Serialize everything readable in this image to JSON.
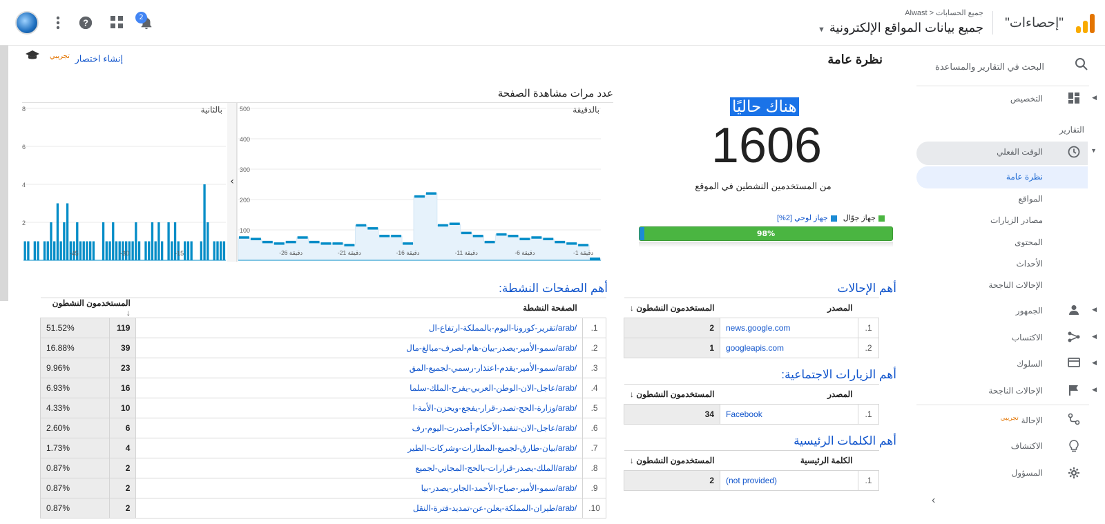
{
  "topbar": {
    "product_name": "\"إحصاءات\"",
    "breadcrumb_root": "جميع الحسابات",
    "breadcrumb_sep": "<",
    "breadcrumb_account": "Alwast",
    "property": "جميع بيانات المواقع الإلكترونية",
    "notifications_count": "2",
    "icons": [
      "analytics-logo",
      "chevron-down-icon",
      "notifications-bell-icon",
      "apps-grid-icon",
      "help-icon",
      "more-vert-icon",
      "avatar"
    ]
  },
  "sidebar": {
    "search_label": "البحث في التقارير والمساعدة",
    "customization": "التخصيص",
    "reports_heading": "التقارير",
    "realtime": "الوقت الفعلي",
    "realtime_sub": [
      "نظرة عامة",
      "المواقع",
      "مصادر الزيارات",
      "المحتوى",
      "الأحداث",
      "الإحالات الناجحة"
    ],
    "audience": "الجمهور",
    "acquisition": "الاكتساب",
    "behavior": "السلوك",
    "conversions": "الإحالات الناجحة",
    "attribution": "الإحالة",
    "attribution_badge": "تجريبي",
    "discover": "الاكتشاف",
    "admin": "المسؤول",
    "collapse": "›"
  },
  "main": {
    "title": "نظرة عامة",
    "shortcut_label": "إنشاء اختصار",
    "shortcut_badge": "تجريبي"
  },
  "realtime": {
    "now_label": "هناك حاليًا",
    "active_count": "1606",
    "sub_label": "من المستخدمين النشطين في الموقع",
    "legend_mobile": "جهاز جوّال",
    "legend_tablet": "جهاز لوحي [2%]",
    "mobile_pct_label": "98%",
    "mobile_fraction": 0.98,
    "tablet_fraction": 0.02,
    "colors": {
      "mobile": "#4ab541",
      "tablet": "#1c8bd4",
      "highlight": "#1a73e8"
    }
  },
  "chart_data": [
    {
      "type": "bar",
      "title": "عدد مرات مشاهدة الصفحة",
      "panel_label": "بالثانية",
      "yticks": [
        "8",
        "6",
        "4",
        "2"
      ],
      "ylim": [
        0,
        8
      ],
      "xtick_labels": [
        "-45",
        "-30",
        "-15"
      ],
      "values": [
        1,
        1,
        0,
        1,
        1,
        0,
        1,
        1,
        2,
        1,
        3,
        1,
        2,
        3,
        1,
        1,
        2,
        1,
        1,
        1,
        1,
        1,
        0,
        0,
        2,
        1,
        1,
        2,
        1,
        1,
        1,
        1,
        1,
        1,
        2,
        1,
        0,
        1,
        1,
        2,
        1,
        2,
        1,
        0,
        2,
        1,
        2,
        1,
        0,
        1,
        1,
        1,
        0,
        0,
        1,
        4,
        2,
        0,
        1,
        1,
        1,
        1
      ]
    },
    {
      "type": "area",
      "panel_label": "بالدقيقة",
      "yticks": [
        "500",
        "400",
        "300",
        "200",
        "100"
      ],
      "ylim": [
        0,
        500
      ],
      "xtick_labels": [
        "-26 دقيقة",
        "-21 دقيقة",
        "-16 دقيقة",
        "-11 دقيقة",
        "-6 دقيقة",
        "-1 دقيقة"
      ],
      "values": [
        75,
        70,
        60,
        55,
        60,
        75,
        60,
        55,
        55,
        50,
        115,
        105,
        80,
        80,
        55,
        210,
        220,
        115,
        120,
        90,
        80,
        60,
        85,
        80,
        70,
        75,
        70,
        60,
        55,
        50,
        5
      ]
    }
  ],
  "top_referrals": {
    "title": "أهم الإحالات",
    "col_source": "المصدر",
    "col_users": "المستخدمون النشطون",
    "rows": [
      {
        "n": "1.",
        "source": "news.google.com",
        "users": "2"
      },
      {
        "n": "2.",
        "source": "googleapis.com",
        "users": "1"
      }
    ]
  },
  "top_social": {
    "title": "أهم الزيارات الاجتماعية:",
    "col_source": "المصدر",
    "col_users": "المستخدمون النشطون",
    "rows": [
      {
        "n": "1.",
        "source": "Facebook",
        "users": "34"
      }
    ]
  },
  "top_keywords": {
    "title": "أهم الكلمات الرئيسية",
    "col_keyword": "الكلمة الرئيسية",
    "col_users": "المستخدمون النشطون",
    "rows": [
      {
        "n": "1.",
        "source": "(not provided)",
        "users": "2"
      }
    ]
  },
  "top_pages": {
    "title": "أهم الصفحات النشطة:",
    "col_page": "الصفحة النشطة",
    "col_users": "المستخدمون النشطون",
    "rows": [
      {
        "n": "1.",
        "page": "/arab/تقرير-كورونا-اليوم-بالمملكة-ارتفاع-ال",
        "users": "119",
        "pct": "51.52%"
      },
      {
        "n": "2.",
        "page": "/arab/سمو-الأمير-يصدر-بيان-هام-لصرف-مبالغ-مال",
        "users": "39",
        "pct": "16.88%"
      },
      {
        "n": "3.",
        "page": "/arab/سمو-الأمير-يقدم-اعتذار-رسمي-لجميع-المق",
        "users": "23",
        "pct": "9.96%"
      },
      {
        "n": "4.",
        "page": "/arab/عاجل-الان-الوطن-العربي-يفرح-الملك-سلما",
        "users": "16",
        "pct": "6.93%"
      },
      {
        "n": "5.",
        "page": "/arab/وزارة-الحج-تصدر-قرار-يفجع-ويحزن-الأمة-ا",
        "users": "10",
        "pct": "4.33%"
      },
      {
        "n": "6.",
        "page": "/arab/عاجل-الان-تنفيذ-الأحكام-أصدرت-اليوم-رف",
        "users": "6",
        "pct": "2.60%"
      },
      {
        "n": "7.",
        "page": "/arab/بيان-طارق-لجميع-المطارات-وشركات-الطير",
        "users": "4",
        "pct": "1.73%"
      },
      {
        "n": "8.",
        "page": "/arab/الملك-يصدر-قرارات-بالحج-المجاني-لجميع",
        "users": "2",
        "pct": "0.87%"
      },
      {
        "n": "9.",
        "page": "/arab/سمو-الأمير-صباح-الأحمد-الجابر-يصدر-بيا",
        "users": "2",
        "pct": "0.87%"
      },
      {
        "n": "10.",
        "page": "/arab/طيران-المملكة-يعلن-عن-تمديد-فترة-النقل",
        "users": "2",
        "pct": "0.87%"
      }
    ]
  }
}
